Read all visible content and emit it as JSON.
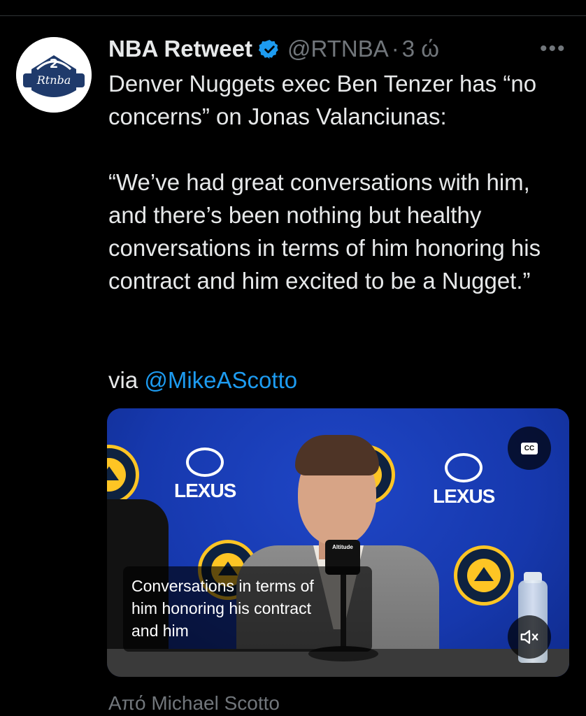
{
  "tweet": {
    "author_name": "NBA Retweet",
    "handle": "@RTNBA",
    "separator": "·",
    "time": "3 ώ",
    "more_label": "•••",
    "avatar_text": "Rtnba",
    "text_line1": "Denver Nuggets exec Ben Tenzer has “no concerns” on Jonas Valanciunas:",
    "quote": "“We’ve had great conversations with him, and there’s been nothing but healthy conversations in terms of him honoring his contract and him excited to be a Nugget.”",
    "via_prefix": "via ",
    "via_mention": "@MikeAScotto"
  },
  "video": {
    "caption_line1": "Conversations in terms of",
    "caption_line2": "him honoring his contract",
    "caption_line3": "and him",
    "cc_label": "CC",
    "sponsor_text": "LEXUS",
    "mic_flag_text": "Altitude",
    "source_label": "Από Michael Scotto"
  },
  "colors": {
    "background": "#000000",
    "text": "#e7e9ea",
    "muted": "#71767b",
    "link": "#1d9bf0",
    "verified": "#1d9bf0"
  },
  "icons": {
    "verified": "verified-badge-icon",
    "more": "more-horizontal-icon",
    "cc": "closed-captions-icon",
    "mute": "volume-muted-icon"
  }
}
